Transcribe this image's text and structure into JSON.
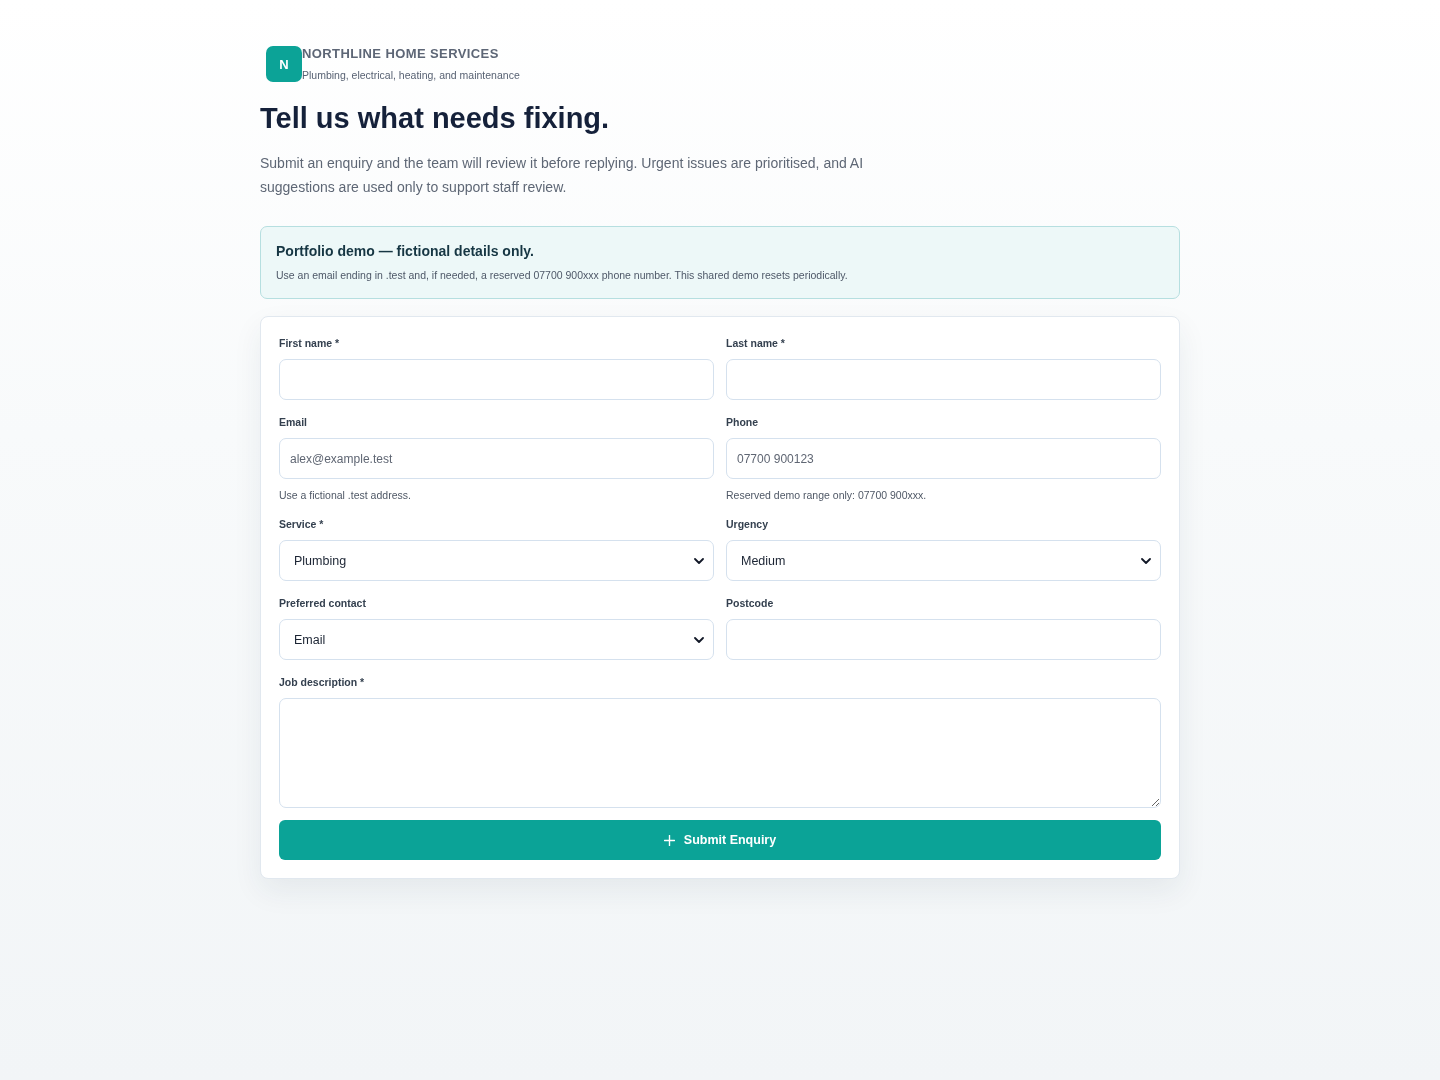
{
  "brand": {
    "logo_letter": "N",
    "name": "NORTHLINE HOME SERVICES",
    "tagline": "Plumbing, electrical, heating, and maintenance"
  },
  "heading": "Tell us what needs fixing.",
  "intro": "Submit an enquiry and the team will review it before replying. Urgent issues are prioritised, and AI suggestions are used only to support staff review.",
  "notice": {
    "title": "Portfolio demo — fictional details only.",
    "text": "Use an email ending in .test and, if needed, a reserved 07700 900xxx phone number. This shared demo resets periodically."
  },
  "form": {
    "fields": [
      {
        "kind": "text",
        "label": "First name *"
      },
      {
        "kind": "text",
        "label": "Last name *"
      },
      {
        "kind": "text",
        "label": "Email",
        "placeholder": "alex@example.test",
        "hint": "Use a fictional .test address."
      },
      {
        "kind": "text",
        "label": "Phone",
        "placeholder": "07700 900123",
        "hint": "Reserved demo range only: 07700 900xxx."
      },
      {
        "kind": "select",
        "label": "Service *",
        "value": "Plumbing"
      },
      {
        "kind": "select",
        "label": "Urgency",
        "value": "Medium"
      },
      {
        "kind": "select",
        "label": "Preferred contact",
        "value": "Email"
      },
      {
        "kind": "text",
        "label": "Postcode"
      },
      {
        "kind": "textarea",
        "label": "Job description *"
      }
    ],
    "submit": {
      "label": "Submit Enquiry"
    }
  }
}
